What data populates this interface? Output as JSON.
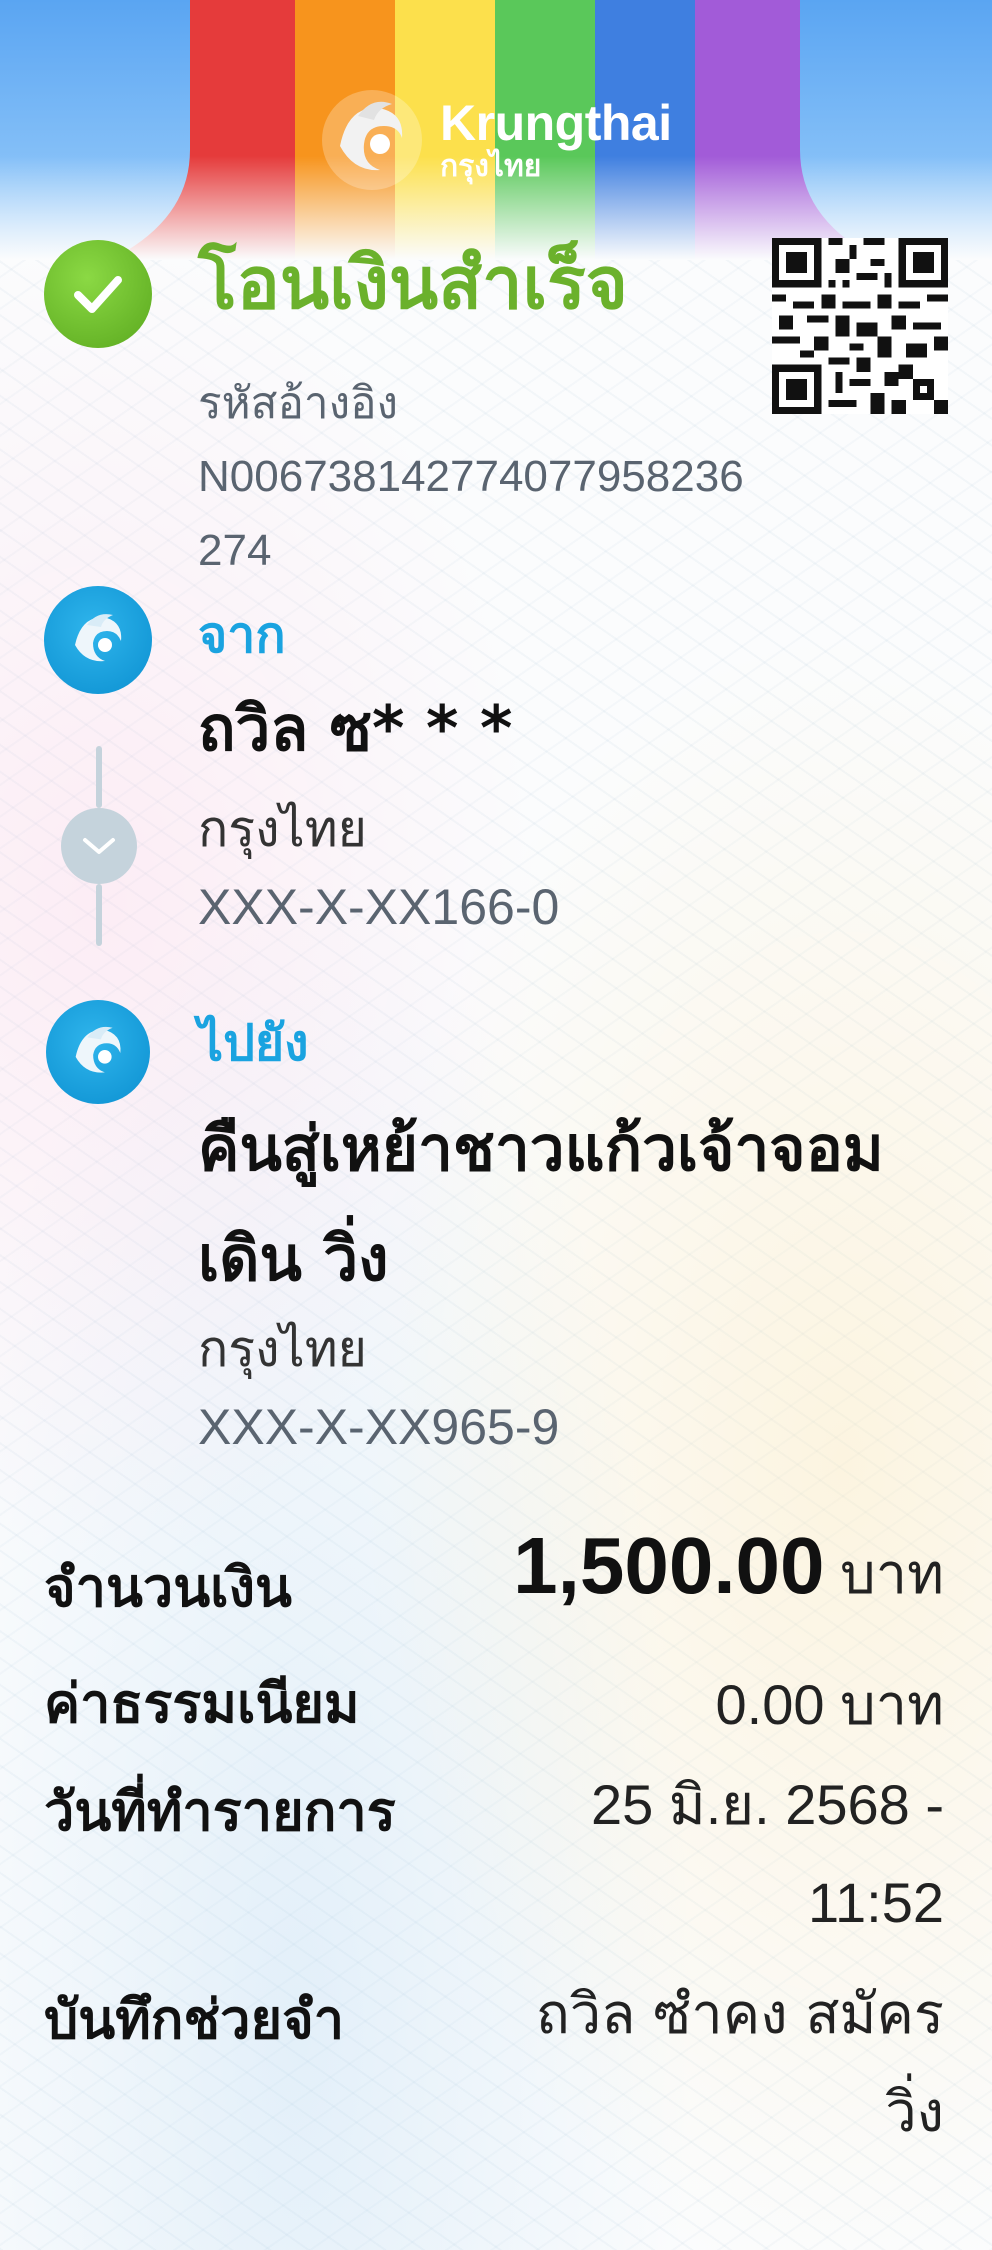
{
  "header": {
    "brand_en": "Krungthai",
    "brand_th": "กรุงไทย",
    "stripe_colors": [
      "#e53b3b",
      "#f7941d",
      "#fce04c",
      "#5ac85a",
      "#3f7fe0",
      "#a25bd8"
    ],
    "sky_color": "#6fb2f5"
  },
  "status": {
    "title": "โอนเงินสำเร็จ",
    "ref_label": "รหัสอ้างอิง",
    "ref_value": "N006738142774077958236274",
    "icon": "check-icon",
    "color": "#6bb12c"
  },
  "from": {
    "label": "จาก",
    "name": "ถวิล ซ* * *",
    "bank": "กรุงไทย",
    "account": "XXX-X-XX166-0"
  },
  "to": {
    "label": "ไปยัง",
    "name": "คืนสู่เหย้าชาวแก้วเจ้าจอม\nเดิน วิ่ง",
    "bank": "กรุงไทย",
    "account": "XXX-X-XX965-9"
  },
  "details": {
    "amount_label": "จำนวนเงิน",
    "amount_value": "1,500.00",
    "amount_unit": "บาท",
    "fee_label": "ค่าธรรมเนียม",
    "fee_value": "0.00",
    "fee_unit": "บาท",
    "date_label": "วันที่ทำรายการ",
    "date_value": "25 มิ.ย. 2568 -\n11:52",
    "memo_label": "บันทึกช่วยจำ",
    "memo_value": "ถวิล ซำคง สมัคร\nวิ่ง"
  },
  "accent_color": "#1aa3e0"
}
